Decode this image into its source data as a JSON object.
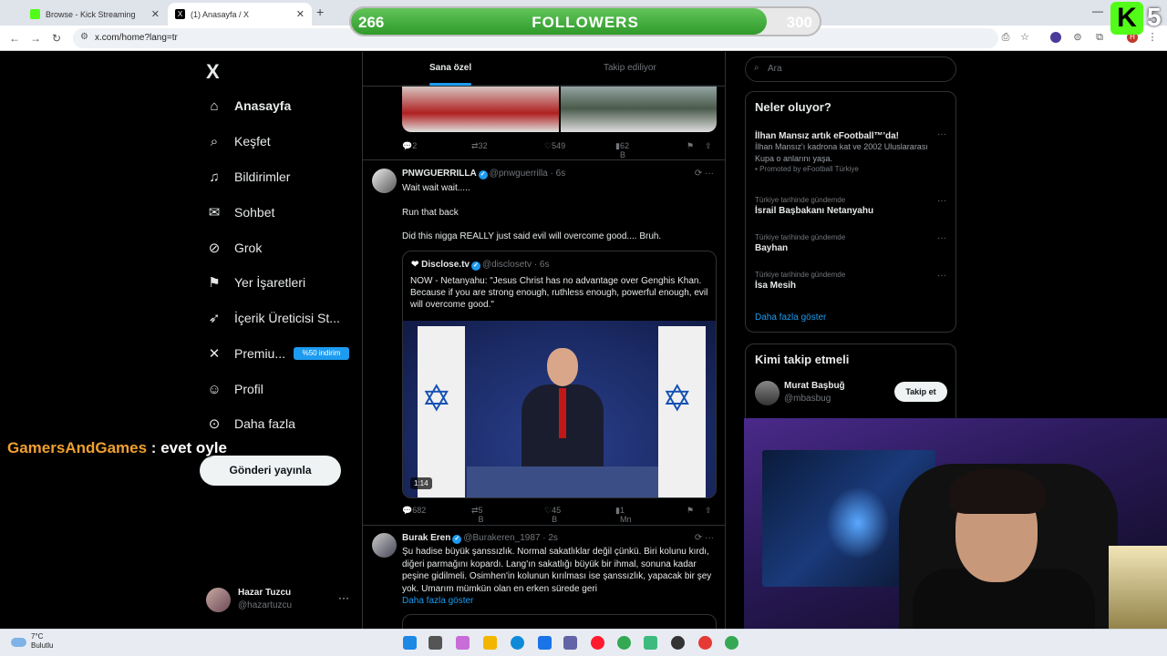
{
  "browser": {
    "tabs": [
      {
        "title": "Browse - Kick Streaming",
        "favicon_color": "#53fc18",
        "active": false
      },
      {
        "title": "(1) Anasayfa / X",
        "favicon_color": "#000000",
        "active": true
      }
    ],
    "url": "x.com/home?lang=tr",
    "new_tab": "+"
  },
  "overlay": {
    "current": "266",
    "label": "FOLLOWERS",
    "goal": "300",
    "progress": 0.887,
    "kick_count": "5",
    "kick_letter": "K"
  },
  "chat": {
    "user": "GamersAndGames",
    "separator": " : ",
    "text": "evet oyle"
  },
  "sidebar": {
    "logo": "X",
    "items": [
      {
        "label": "Anasayfa",
        "icon": "home-icon"
      },
      {
        "label": "Keşfet",
        "icon": "search-icon"
      },
      {
        "label": "Bildirimler",
        "icon": "bell-icon"
      },
      {
        "label": "Sohbet",
        "icon": "mail-icon"
      },
      {
        "label": "Grok",
        "icon": "grok-icon"
      },
      {
        "label": "Yer İşaretleri",
        "icon": "bookmark-icon"
      },
      {
        "label": "İçerik Üreticisi St...",
        "icon": "rocket-icon"
      },
      {
        "label": "Premiu...",
        "icon": "x-icon"
      },
      {
        "label": "Profil",
        "icon": "person-icon"
      },
      {
        "label": "Daha fazla",
        "icon": "more-circle-icon"
      }
    ],
    "premium_badge": "%50 indirim",
    "post_button": "Gönderi yayınla",
    "profile": {
      "name": "Hazar Tuzcu",
      "handle": "@hazartuzcu",
      "more": "···"
    }
  },
  "feed": {
    "tabs": [
      "Sana özel",
      "Takip ediliyor"
    ],
    "top_tweet_actions": {
      "replies": "2",
      "retweets": "32",
      "likes": "549",
      "views": "62 B"
    },
    "tweet1": {
      "name": "PNWGUERRILLA",
      "handle": "@pnwguerrilla · 6s",
      "lines": [
        "Wait wait wait.....",
        "Run that back",
        "Did this nigga REALLY just said evil will overcome good.... Bruh."
      ],
      "quote": {
        "name": "Disclose.tv",
        "handle": "@disclosetv · 6s",
        "text": "NOW - Netanyahu: \"Jesus Christ has no advantage over Genghis Khan. Because if you are strong enough, ruthless enough, powerful enough, evil will overcome good.\"",
        "video_time": "1:14"
      },
      "actions": {
        "replies": "682",
        "retweets": "5 B",
        "likes": "45 B",
        "views": "1 Mn"
      }
    },
    "tweet2": {
      "name": "Burak Eren",
      "handle": "@Burakeren_1987 · 2s",
      "text": "Şu hadise büyük şanssızlık. Normal sakatlıklar değil çünkü. Biri kolunu kırdı, diğeri parmağını kopardı. Lang'ın sakatlığı büyük bir ihmal, sonuna kadar peşine gidilmeli. Osimhen'in kolunun kırılması ise şanssızlık, yapacak bir şey yok. Umarım mümkün olan en erken sürede geri",
      "more": "Daha fazla göster"
    }
  },
  "right": {
    "search_placeholder": "Ara",
    "trends_title": "Neler oluyor?",
    "trends": [
      {
        "meta": "",
        "title": "İlhan Mansız artık eFootball™'da!",
        "sub": "İlhan Mansız'ı kadrona kat ve 2002 Uluslararası Kupa o anlarını yaşa.",
        "promo": "Promoted by eFootball Türkiye"
      },
      {
        "meta": "Türkiye tarihinde gündemde",
        "title": "İsrail Başbakanı Netanyahu"
      },
      {
        "meta": "Türkiye tarihinde gündemde",
        "title": "Bayhan"
      },
      {
        "meta": "Türkiye tarihinde gündemde",
        "title": "İsa Mesih"
      }
    ],
    "show_more": "Daha fazla göster",
    "wtf_title": "Kimi takip etmeli",
    "wtf_user": {
      "name": "Murat Başbuğ",
      "handle": "@mbasbug",
      "button": "Takip et"
    }
  },
  "taskbar": {
    "temp": "7°C",
    "condition": "Bulutlu"
  }
}
